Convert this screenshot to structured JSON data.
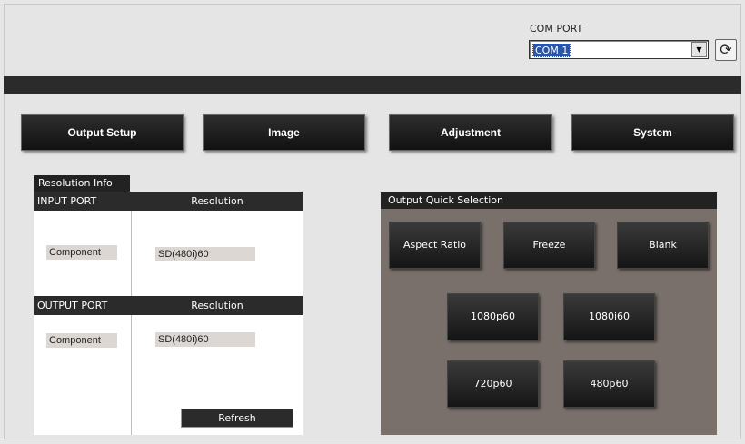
{
  "com_port": {
    "label": "COM PORT",
    "selected": "COM 1"
  },
  "nav": {
    "output_setup": "Output Setup",
    "image": "Image",
    "adjustment": "Adjustment",
    "system": "System"
  },
  "resolution_info": {
    "title": "Resolution Info",
    "input": {
      "port_header": "INPUT PORT",
      "res_header": "Resolution",
      "port": "Component",
      "resolution": "SD(480i)60"
    },
    "output": {
      "port_header": "OUTPUT PORT",
      "res_header": "Resolution",
      "port": "Component",
      "resolution": "SD(480i)60"
    },
    "refresh_label": "Refresh"
  },
  "quick_selection": {
    "title": "Output Quick Selection",
    "aspect_ratio": "Aspect Ratio",
    "freeze": "Freeze",
    "blank": "Blank",
    "r1080p60": "1080p60",
    "r1080i60": "1080i60",
    "r720p60": "720p60",
    "r480p60": "480p60"
  },
  "icons": {
    "refresh_port": "refresh-icon",
    "dropdown": "chevron-down-icon"
  }
}
